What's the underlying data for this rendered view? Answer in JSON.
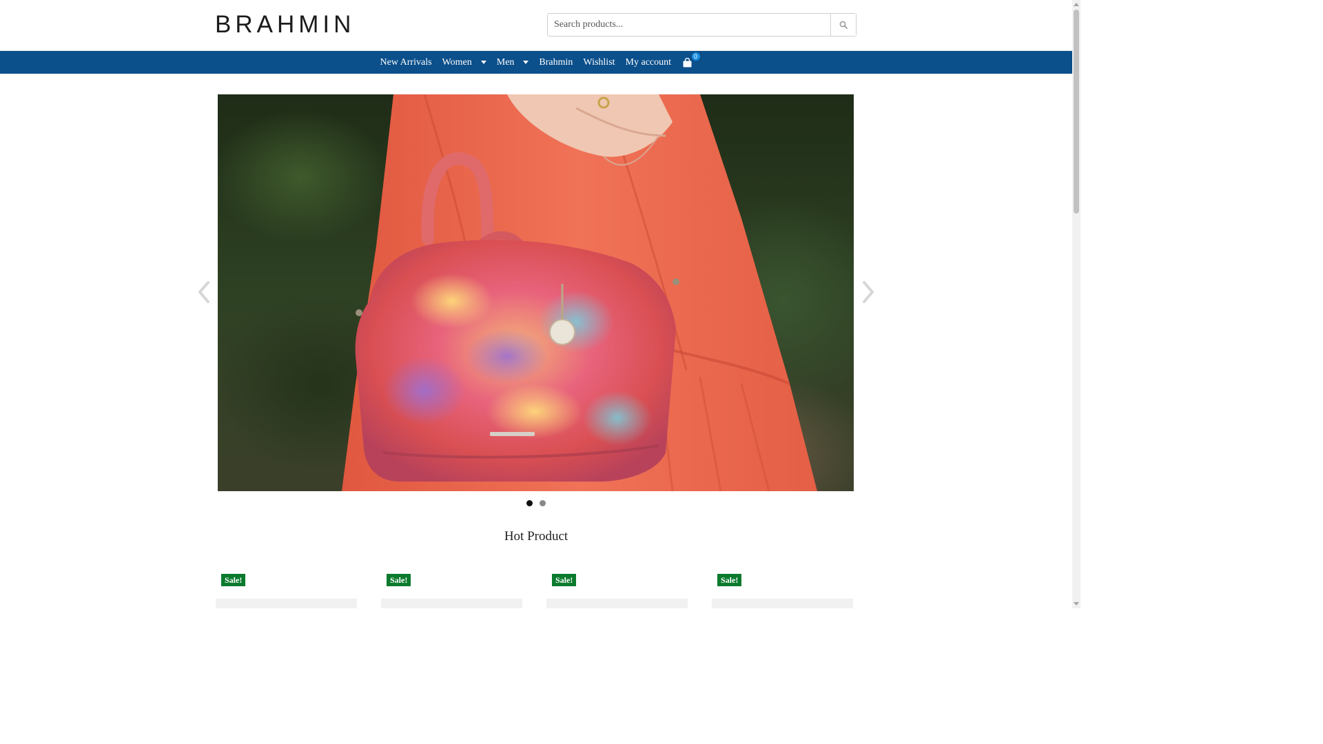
{
  "header": {
    "logo_text": "BRAHMIN",
    "search": {
      "placeholder": "Search products...",
      "value": ""
    }
  },
  "nav": {
    "items": [
      {
        "label": "New Arrivals",
        "has_dropdown": false
      },
      {
        "label": "Women",
        "has_dropdown": true
      },
      {
        "label": "Men",
        "has_dropdown": true
      },
      {
        "label": "Brahmin",
        "has_dropdown": false
      },
      {
        "label": "Wishlist",
        "has_dropdown": false
      },
      {
        "label": "My account",
        "has_dropdown": false
      }
    ],
    "cart_count": "0",
    "cart_icon": "shopping-bag-icon"
  },
  "slider": {
    "prev_icon": "chevron-left-icon",
    "next_icon": "chevron-right-icon",
    "dots": [
      {
        "label": "1",
        "active": true
      },
      {
        "label": "2",
        "active": false
      }
    ]
  },
  "section": {
    "title": "Hot Product"
  },
  "products": [
    {
      "badge": "Sale!"
    },
    {
      "badge": "Sale!"
    },
    {
      "badge": "Sale!"
    },
    {
      "badge": "Sale!"
    }
  ],
  "colors": {
    "nav_background": "#0b4f8b",
    "sale_badge": "#0b7a2e",
    "cart_badge": "#1b8fe0"
  }
}
